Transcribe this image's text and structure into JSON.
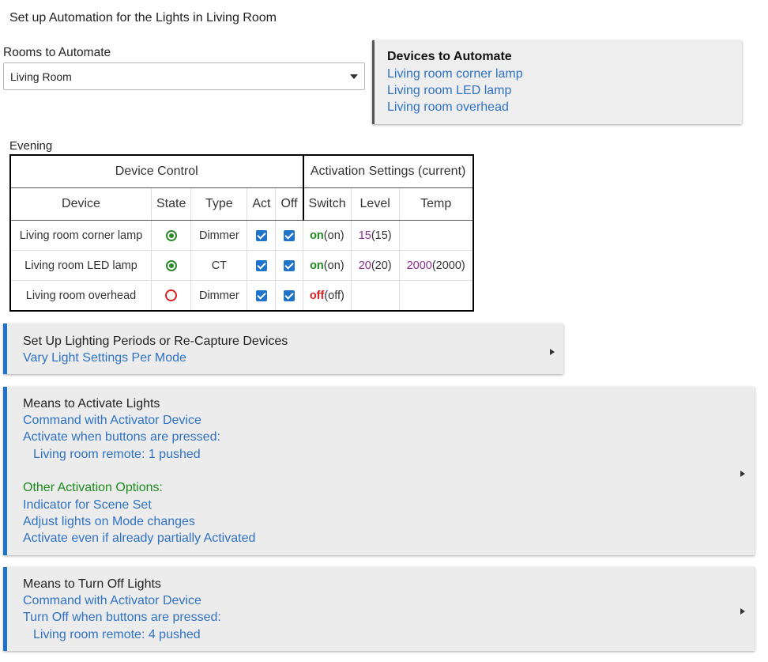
{
  "page_title": "Set up Automation for the Lights in Living Room",
  "rooms": {
    "label": "Rooms to Automate",
    "selected": "Living Room"
  },
  "devices_box": {
    "title": "Devices to Automate",
    "devices": [
      "Living room corner lamp",
      "Living room LED lamp",
      "Living room overhead"
    ]
  },
  "table": {
    "period": "Evening",
    "group_headers": [
      "Device Control",
      "Activation Settings (current)"
    ],
    "columns": [
      "Device",
      "State",
      "Type",
      "Act",
      "Off",
      "Switch",
      "Level",
      "Temp"
    ],
    "rows": [
      {
        "device": "Living room corner lamp",
        "state": "on",
        "type": "Dimmer",
        "act": true,
        "off": true,
        "switch": "on",
        "switch_cur": "(on)",
        "level": "15",
        "level_cur": "(15)",
        "temp": "",
        "temp_cur": ""
      },
      {
        "device": "Living room LED lamp",
        "state": "on",
        "type": "CT",
        "act": true,
        "off": true,
        "switch": "on",
        "switch_cur": "(on)",
        "level": "20",
        "level_cur": "(20)",
        "temp": "2000",
        "temp_cur": "(2000)"
      },
      {
        "device": "Living room overhead",
        "state": "off",
        "type": "Dimmer",
        "act": true,
        "off": true,
        "switch": "off",
        "switch_cur": "(off)",
        "level": "",
        "level_cur": "",
        "temp": "",
        "temp_cur": ""
      }
    ]
  },
  "panels": {
    "periods": {
      "title": "Set Up Lighting Periods or Re-Capture Devices",
      "subtitle": "Vary Light Settings Per Mode"
    },
    "activate": {
      "title": "Means to Activate Lights",
      "line1": "Command with Activator Device",
      "line2": "Activate when buttons are pressed:",
      "line3": "Living room remote: 1 pushed",
      "other_title": "Other Activation Options:",
      "opt1": "Indicator for Scene Set",
      "opt2": "Adjust lights on Mode changes",
      "opt3": "Activate even if already partially Activated"
    },
    "turnoff": {
      "title": "Means to Turn Off Lights",
      "line1": "Command with Activator Device",
      "line2": "Turn Off when buttons are pressed:",
      "line3": "Living room remote: 4 pushed"
    }
  },
  "colors": {
    "link_blue": "#2f72c4",
    "panel_accent": "#1f73c9",
    "device_purple": "#8b2c8b",
    "on_green": "#1c8a1c",
    "off_red": "#e02020"
  }
}
